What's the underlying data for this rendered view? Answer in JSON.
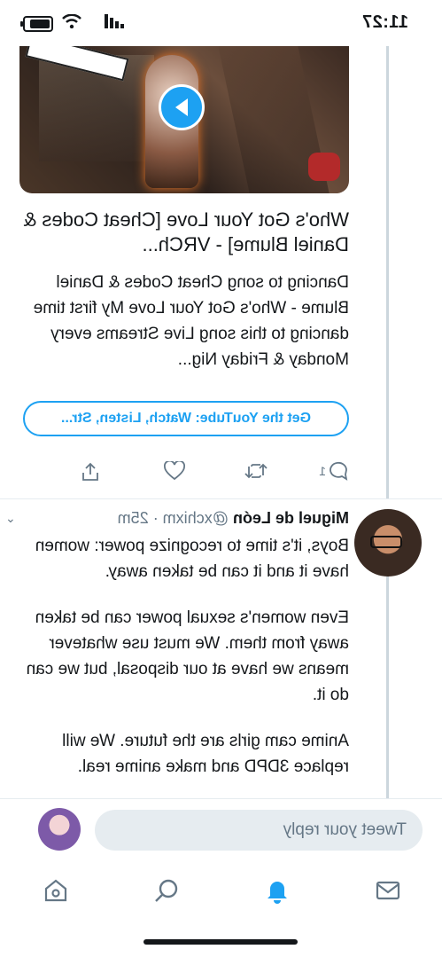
{
  "status_bar": {
    "time": "11:27"
  },
  "card": {
    "title": "Who's Got Your Love [Cheat Codes & Daniel Blume] - VRCh...",
    "description": "Dancing to song Cheat Codes & Daniel Blume - Who's Got Your Love My first time dancing to this song Live Streams every Monday & Friday Nig...",
    "link_label": "Get the YouTube: Watch, Listen, Str..."
  },
  "actions": {
    "reply_count": "1"
  },
  "tweet": {
    "name": "Miguel de León",
    "handle": "@xchixm · 25m",
    "paragraphs": [
      "Boys, it's time to recognize power: women have it and it can be taken away.",
      "Even women's sexual power can be taken away from them. We must use whatever means we have at our disposal, but we can do it.",
      "Anime cam girls are the future. We will replace 3DPD and make anime real."
    ]
  },
  "composer": {
    "placeholder": "Tweet your reply"
  },
  "colors": {
    "accent": "#1da1f2",
    "muted": "#657786",
    "text": "#14171a"
  },
  "icons": [
    "home-icon",
    "search-icon",
    "notifications-bell-icon",
    "messages-icon",
    "reply-icon",
    "retweet-icon",
    "like-icon",
    "share-icon",
    "play-icon",
    "chevron-down-icon"
  ]
}
